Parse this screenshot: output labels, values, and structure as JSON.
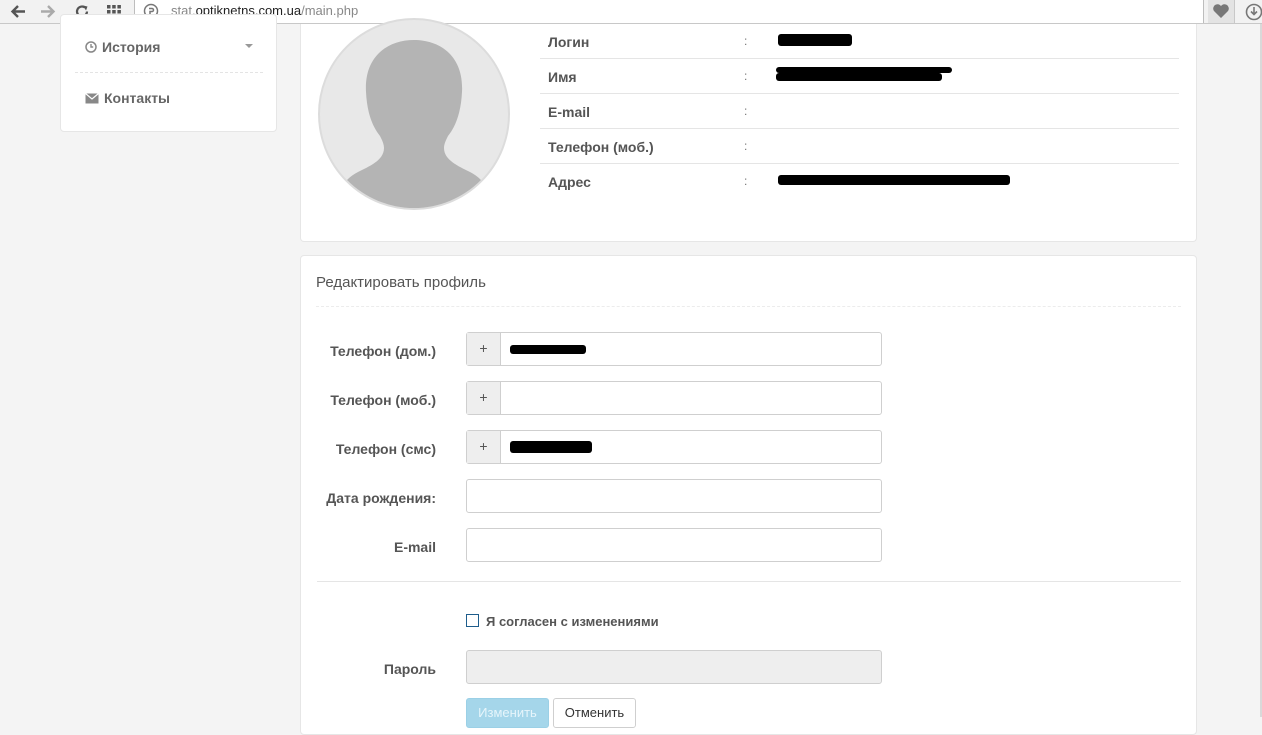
{
  "browser": {
    "url_prefix": "stat.",
    "url_domain": "optiknetns.com.ua",
    "url_path": "/main.php"
  },
  "sidebar": {
    "items": [
      {
        "label": "История",
        "icon": "clock-icon"
      },
      {
        "label": "Контакты",
        "icon": "envelope-icon"
      }
    ]
  },
  "profile": {
    "rows": [
      {
        "label": "Логин",
        "sep": ":"
      },
      {
        "label": "Имя",
        "sep": ":"
      },
      {
        "label": "E-mail",
        "sep": ":"
      },
      {
        "label": "Телефон (моб.)",
        "sep": ":"
      },
      {
        "label": "Адрес",
        "sep": ":"
      }
    ]
  },
  "edit_form": {
    "title": "Редактировать профиль",
    "fields": [
      {
        "label": "Телефон (дом.)",
        "addon": "+",
        "value": ""
      },
      {
        "label": "Телефон (моб.)",
        "addon": "+",
        "value": ""
      },
      {
        "label": "Телефон (смс)",
        "addon": "+",
        "value": ""
      },
      {
        "label": "Дата рождения:",
        "value": ""
      },
      {
        "label": "E-mail",
        "value": ""
      }
    ],
    "agree_label": "Я согласен с изменениями",
    "password_label": "Пароль",
    "submit_label": "Изменить",
    "cancel_label": "Отменить"
  },
  "colors": {
    "primary_button": "#a5d6ea",
    "checkbox_border": "#1e5d8c"
  }
}
